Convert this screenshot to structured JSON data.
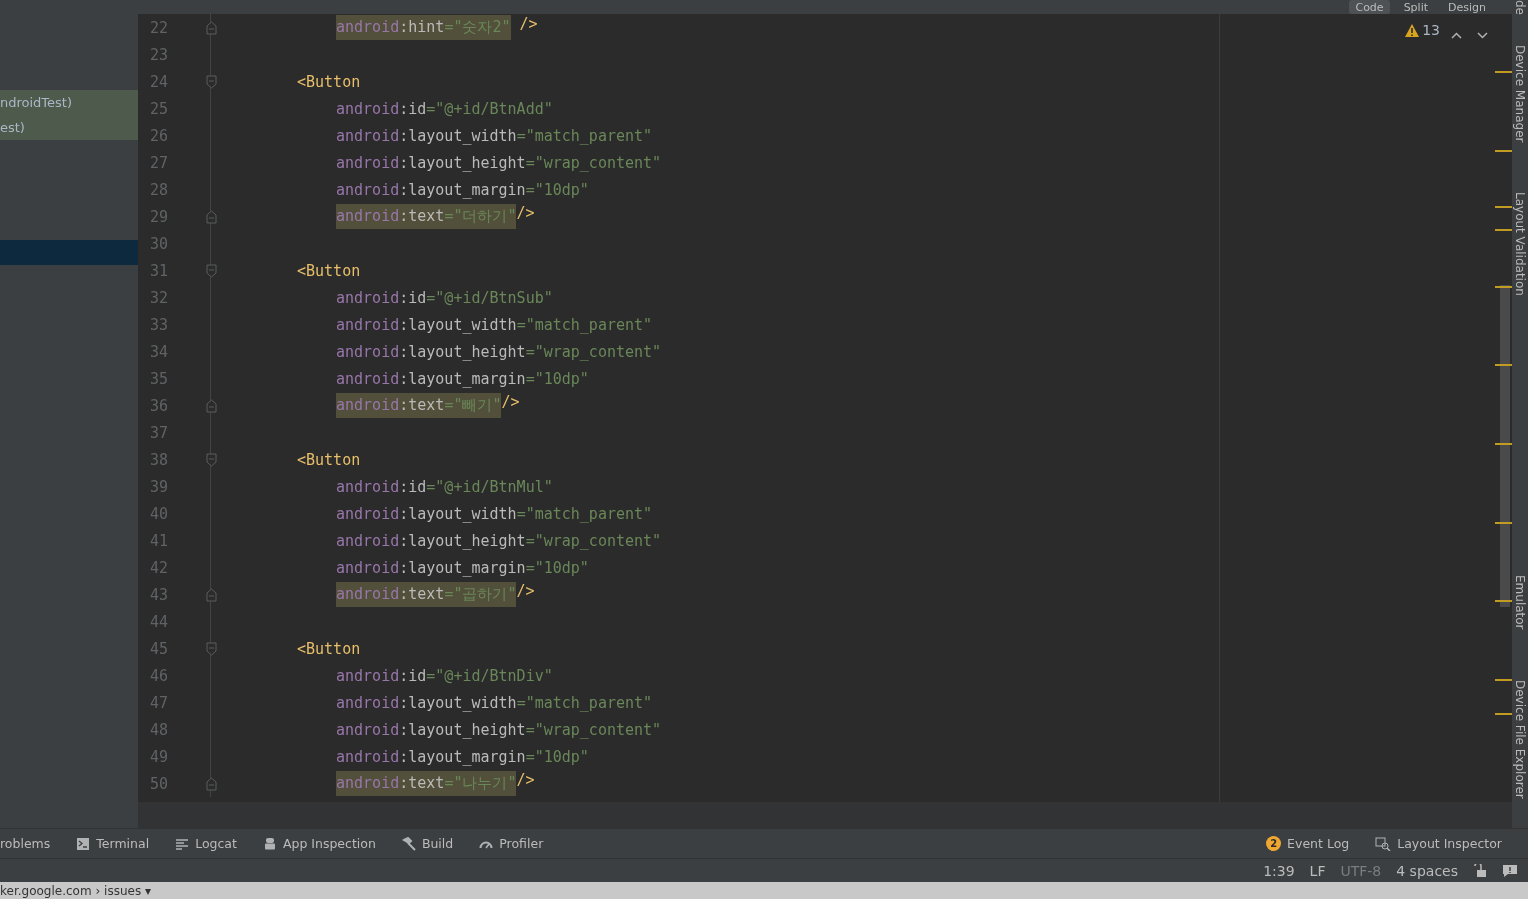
{
  "view_modes": [
    {
      "label": "Code",
      "selected": true
    },
    {
      "label": "Split",
      "selected": false
    },
    {
      "label": "Design",
      "selected": false
    }
  ],
  "project_panel": {
    "rows": [
      {
        "text": "ndroidTest)",
        "kind": "highlighted",
        "selected": false
      },
      {
        "text": "est)",
        "kind": "highlighted",
        "selected": false
      },
      {
        "kind": "plain",
        "selected": true
      }
    ]
  },
  "editor": {
    "lines": [
      {
        "number": "22",
        "kind": "attr",
        "text": "android:hint=\"숫자2\"",
        "tail": " />",
        "highlighted": true
      },
      {
        "number": "23",
        "kind": "blank"
      },
      {
        "number": "24",
        "kind": "tag",
        "text": "<Button"
      },
      {
        "number": "25",
        "kind": "attr",
        "text": "android:id=\"@+id/BtnAdd\"",
        "highlighted": false
      },
      {
        "number": "26",
        "kind": "attr",
        "text": "android:layout_width=\"match_parent\"",
        "highlighted": false
      },
      {
        "number": "27",
        "kind": "attr",
        "text": "android:layout_height=\"wrap_content\"",
        "highlighted": false
      },
      {
        "number": "28",
        "kind": "attr",
        "text": "android:layout_margin=\"10dp\"",
        "highlighted": false
      },
      {
        "number": "29",
        "kind": "attr",
        "text": "android:text=\"더하기\"",
        "tail": "/>",
        "highlighted": true
      },
      {
        "number": "30",
        "kind": "blank"
      },
      {
        "number": "31",
        "kind": "tag",
        "text": "<Button"
      },
      {
        "number": "32",
        "kind": "attr",
        "text": "android:id=\"@+id/BtnSub\"",
        "highlighted": false
      },
      {
        "number": "33",
        "kind": "attr",
        "text": "android:layout_width=\"match_parent\"",
        "highlighted": false
      },
      {
        "number": "34",
        "kind": "attr",
        "text": "android:layout_height=\"wrap_content\"",
        "highlighted": false
      },
      {
        "number": "35",
        "kind": "attr",
        "text": "android:layout_margin=\"10dp\"",
        "highlighted": false
      },
      {
        "number": "36",
        "kind": "attr",
        "text": "android:text=\"빼기\"",
        "tail": "/>",
        "highlighted": true
      },
      {
        "number": "37",
        "kind": "blank"
      },
      {
        "number": "38",
        "kind": "tag",
        "text": "<Button"
      },
      {
        "number": "39",
        "kind": "attr",
        "text": "android:id=\"@+id/BtnMul\"",
        "highlighted": false
      },
      {
        "number": "40",
        "kind": "attr",
        "text": "android:layout_width=\"match_parent\"",
        "highlighted": false
      },
      {
        "number": "41",
        "kind": "attr",
        "text": "android:layout_height=\"wrap_content\"",
        "highlighted": false
      },
      {
        "number": "42",
        "kind": "attr",
        "text": "android:layout_margin=\"10dp\"",
        "highlighted": false
      },
      {
        "number": "43",
        "kind": "attr",
        "text": "android:text=\"곱하기\"",
        "tail": "/>",
        "highlighted": true
      },
      {
        "number": "44",
        "kind": "blank"
      },
      {
        "number": "45",
        "kind": "tag",
        "text": "<Button"
      },
      {
        "number": "46",
        "kind": "attr",
        "text": "android:id=\"@+id/BtnDiv\"",
        "highlighted": false
      },
      {
        "number": "47",
        "kind": "attr",
        "text": "android:layout_width=\"match_parent\"",
        "highlighted": false
      },
      {
        "number": "48",
        "kind": "attr",
        "text": "android:layout_height=\"wrap_content\"",
        "highlighted": false
      },
      {
        "number": "49",
        "kind": "attr",
        "text": "android:layout_margin=\"10dp\"",
        "highlighted": false
      },
      {
        "number": "50",
        "kind": "attr",
        "text": "android:text=\"나누기\"",
        "tail": "/>",
        "highlighted": true
      }
    ],
    "warnings": "13"
  },
  "right_tools": [
    {
      "label": "de"
    },
    {
      "label": "Device Manager"
    },
    {
      "label": "Layout Validation"
    },
    {
      "label": "Emulator"
    },
    {
      "label": "Device File Explorer"
    }
  ],
  "tool_windows": [
    {
      "label": "roblems",
      "kind": "plain"
    },
    {
      "label": "Terminal",
      "kind": "terminal"
    },
    {
      "label": "Logcat",
      "kind": "log"
    },
    {
      "label": "App Inspection",
      "kind": "inspection"
    },
    {
      "label": "Build",
      "kind": "build"
    },
    {
      "label": "Profiler",
      "kind": "profiler"
    }
  ],
  "right_tool_windows": [
    {
      "label": "Event Log",
      "badge": "2",
      "kind": "badge"
    },
    {
      "label": "Layout Inspector",
      "kind": "inspector"
    }
  ],
  "status_bar": {
    "position": "1:39",
    "line_separator": "LF",
    "encoding": "UTF-8",
    "indent": "4 spaces"
  },
  "browser_strip": {
    "text": "ker.google.com › issues ▾"
  }
}
